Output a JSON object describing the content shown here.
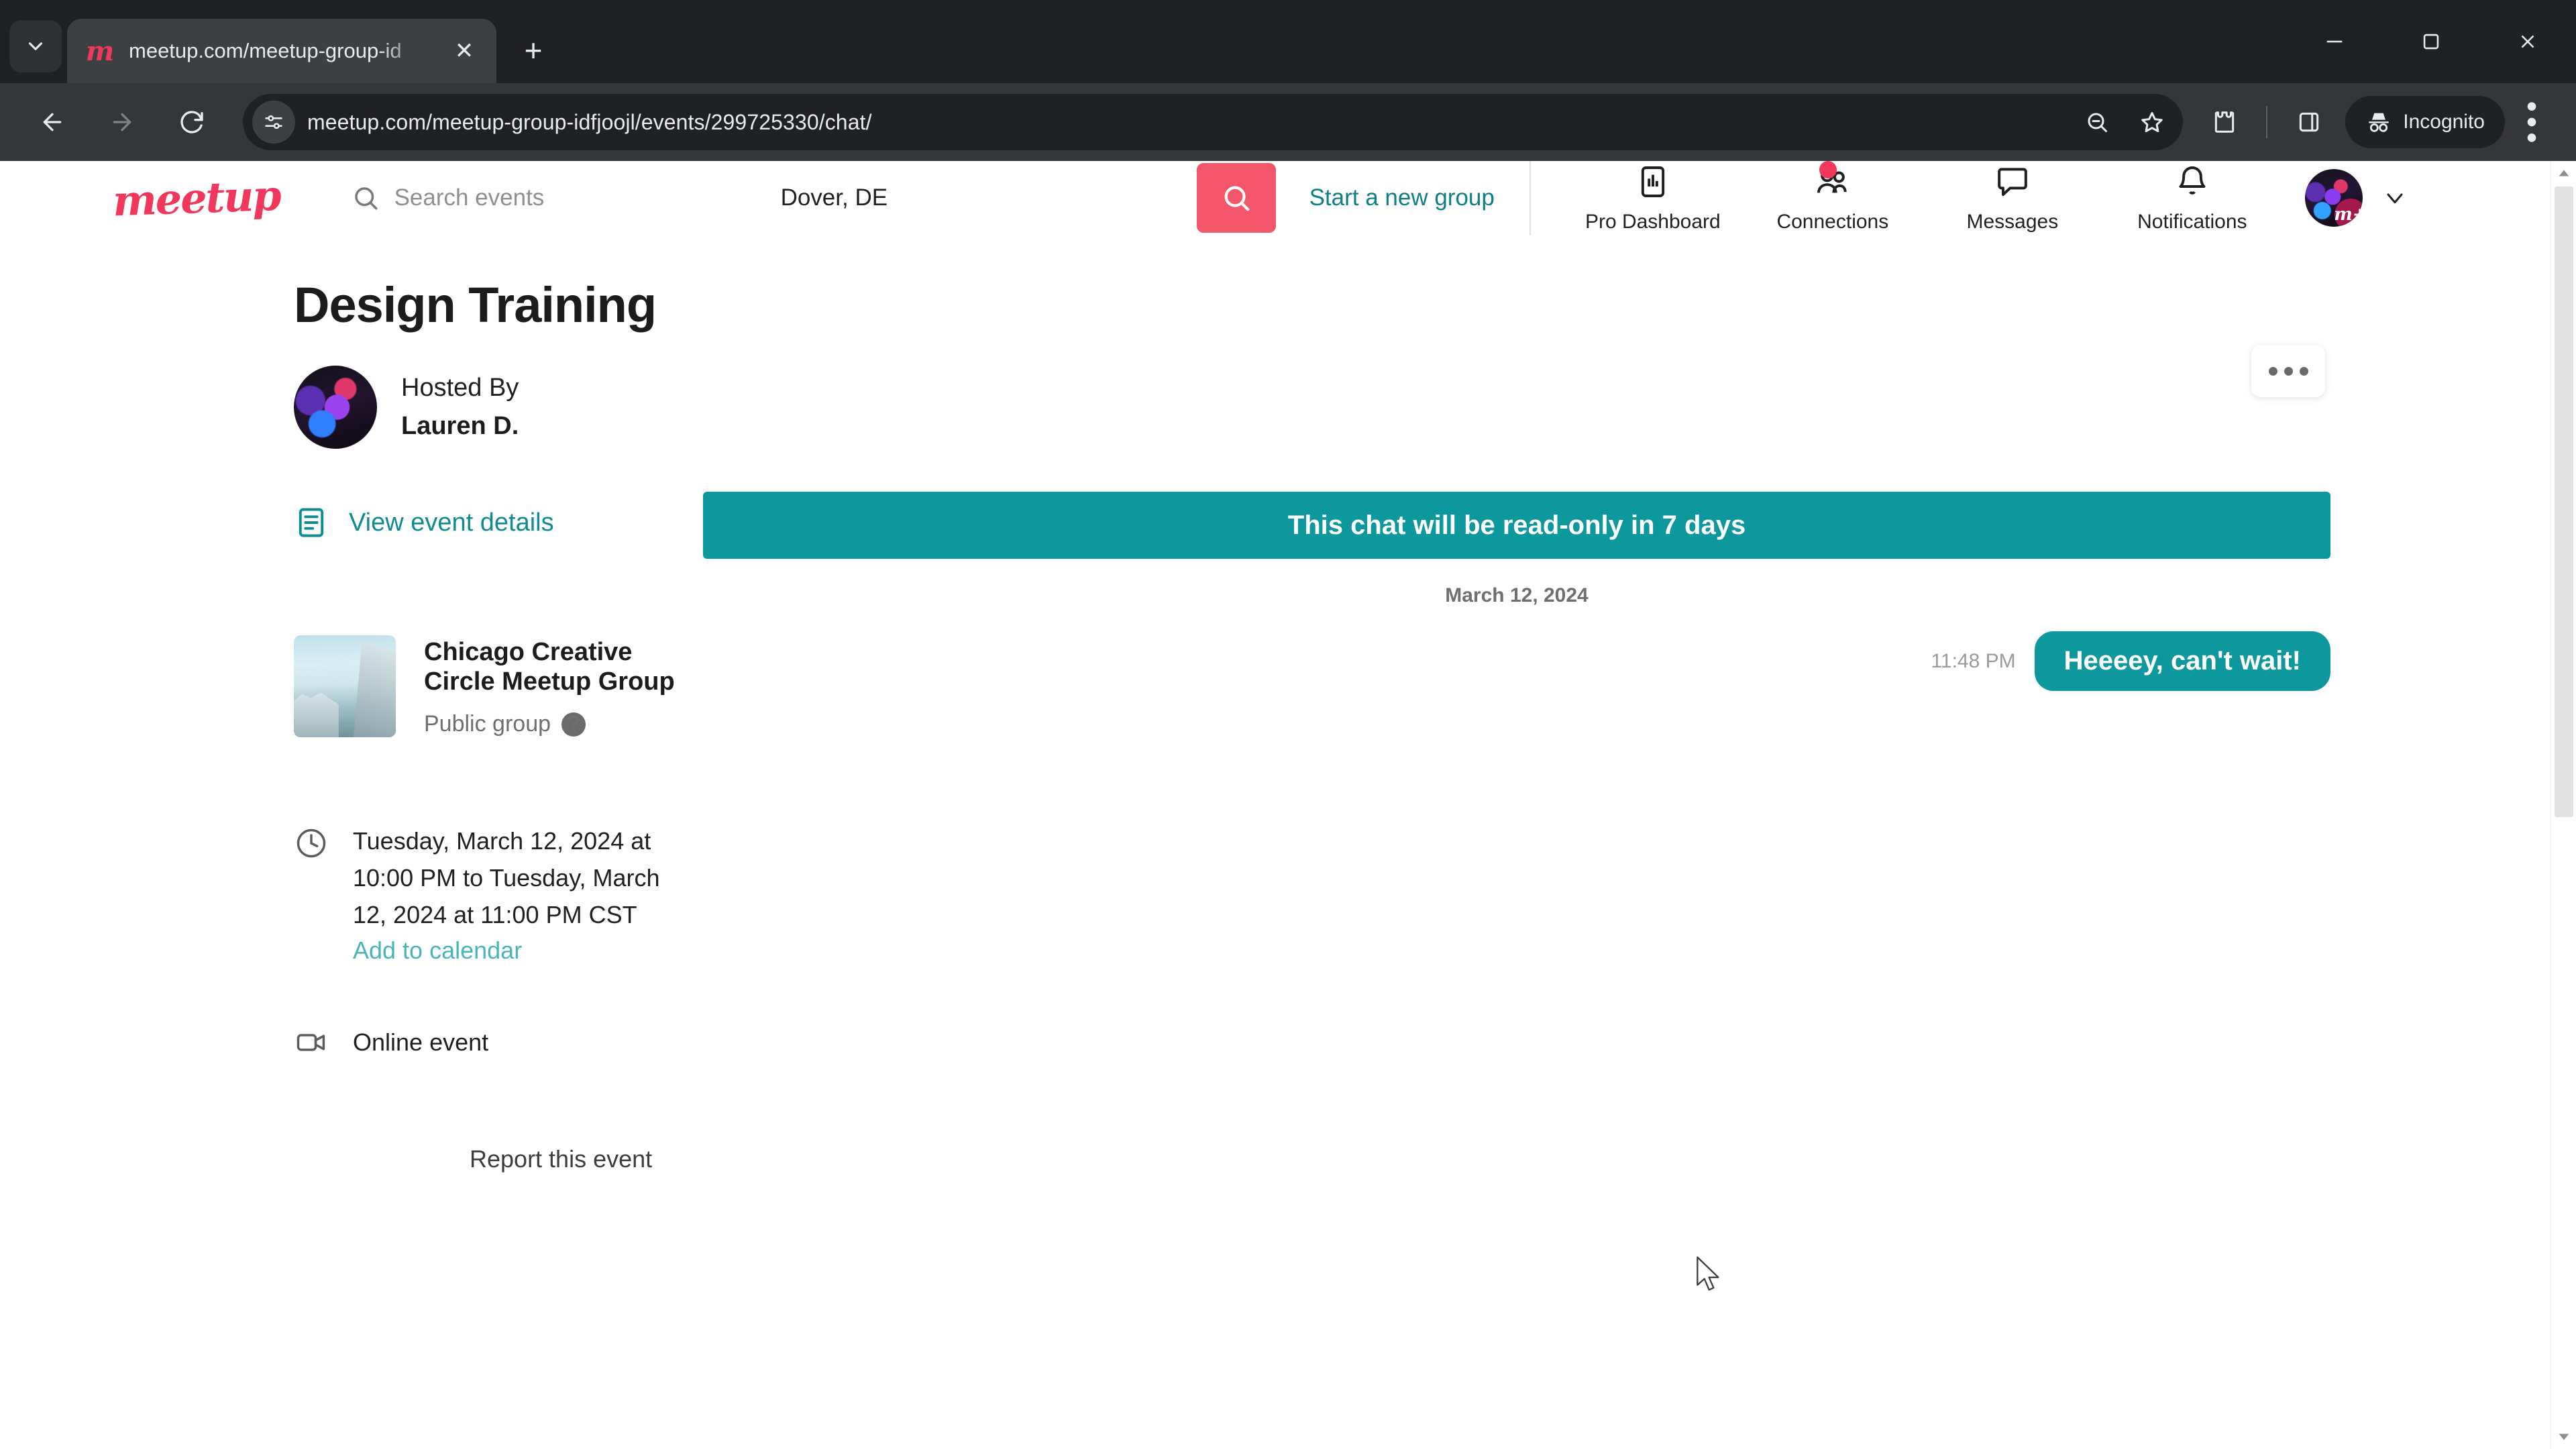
{
  "browser": {
    "tab": {
      "title": "meetup.com/meetup-group-id",
      "favicon_name": "meetup-favicon",
      "close_label": "✕"
    },
    "new_tab_label": "+",
    "omnibox": {
      "url": "meetup.com/meetup-group-idfjoojl/events/299725330/chat/",
      "site_info_icon": "page-settings-icon"
    },
    "toolbar_icons": [
      "zoom-out-icon",
      "bookmark-star-icon",
      "extensions-icon",
      "side-panel-icon"
    ],
    "profile_pill": {
      "label": "Incognito",
      "icon": "incognito-hat-icon"
    },
    "menu_icon": "three-dot-menu-icon",
    "window_controls": [
      "minimize",
      "maximize",
      "close"
    ]
  },
  "site_header": {
    "logo_text": "meetup",
    "search_placeholder": "Search events",
    "location_value": "Dover, DE",
    "search_button_icon": "search-icon",
    "start_group_label": "Start a new group",
    "nav": [
      {
        "label": "Pro Dashboard",
        "icon": "pro-dashboard-icon",
        "badge": false
      },
      {
        "label": "Connections",
        "icon": "connections-people-icon",
        "badge": true
      },
      {
        "label": "Messages",
        "icon": "message-bubble-icon",
        "badge": false
      },
      {
        "label": "Notifications",
        "icon": "bell-icon",
        "badge": false
      }
    ],
    "avatar": {
      "pro_badge": "m+"
    },
    "avatar_chevron": "chevron-down-icon"
  },
  "event": {
    "title": "Design Training",
    "hosted_by_label": "Hosted By",
    "host_name": "Lauren D.",
    "more_menu_label": "•••",
    "view_details_label": "View event details",
    "view_details_icon": "document-lines-icon",
    "group": {
      "name": "Chicago Creative Circle Meetup Group",
      "privacy": "Public group",
      "help_icon": "question-mark-icon"
    },
    "datetime": {
      "icon": "clock-icon",
      "text": "Tuesday, March 12, 2024 at 10:00 PM to Tuesday, March 12, 2024 at 11:00 PM CST",
      "add_to_calendar": "Add to calendar"
    },
    "location": {
      "icon": "video-camera-icon",
      "text": "Online event"
    },
    "report_label": "Report this event"
  },
  "chat": {
    "banner": "This chat will be read-only in 7 days",
    "date_divider": "March 12, 2024",
    "messages": [
      {
        "time": "11:48 PM",
        "text": "Heeeey, can't wait!",
        "outgoing": true
      }
    ]
  },
  "colors": {
    "meetup_red": "#f1385c",
    "teal": "#0d989d",
    "link_teal": "#0f8c93",
    "chrome_dark": "#202124"
  }
}
